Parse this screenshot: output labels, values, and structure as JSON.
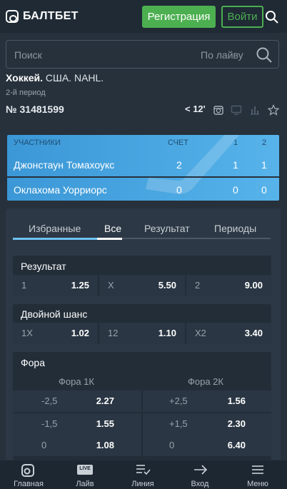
{
  "header": {
    "logo_text": "БАЛТБЕТ",
    "register_label": "Регистрация",
    "login_label": "Войти"
  },
  "search": {
    "placeholder": "Поиск",
    "filter_label": "По лайву"
  },
  "event": {
    "sport": "Хоккей.",
    "league": "США. NAHL.",
    "period": "2-й период",
    "number": "№ 31481599",
    "timer": "< 12'"
  },
  "scoreboard": {
    "headers": {
      "participants": "УЧАСТНИКИ",
      "score": "СЧЕТ",
      "p1": "1",
      "p2": "2"
    },
    "teams": [
      {
        "name": "Джонстаун Томахоукс",
        "score": "2",
        "p1": "1",
        "p2": "1"
      },
      {
        "name": "Оклахома Уорриорс",
        "score": "0",
        "p1": "0",
        "p2": "0"
      }
    ]
  },
  "tabs": [
    "Избранные",
    "Все",
    "Результат",
    "Периоды"
  ],
  "active_tab": "Все",
  "markets": {
    "result": {
      "title": "Результат",
      "odds": [
        {
          "k": "1",
          "v": "1.25"
        },
        {
          "k": "X",
          "v": "5.50"
        },
        {
          "k": "2",
          "v": "9.00"
        }
      ]
    },
    "double": {
      "title": "Двойной шанс",
      "odds": [
        {
          "k": "1X",
          "v": "1.02"
        },
        {
          "k": "12",
          "v": "1.10"
        },
        {
          "k": "X2",
          "v": "3.40"
        }
      ]
    },
    "fora": {
      "title": "Фора",
      "col1": "Фора 1К",
      "col2": "Фора 2К",
      "rows": [
        {
          "k1": "-2,5",
          "v1": "2.27",
          "k2": "+2,5",
          "v2": "1.56"
        },
        {
          "k1": "-1,5",
          "v1": "1.55",
          "k2": "+1,5",
          "v2": "2.30"
        },
        {
          "k1": "0",
          "v1": "1.08",
          "k2": "0",
          "v2": "6.40"
        }
      ]
    }
  },
  "nav": [
    "Главная",
    "Лайв",
    "Линия",
    "Вход",
    "Меню"
  ],
  "nav_live_badge": "LIVE",
  "colors": {
    "accent_green": "#4caf50",
    "scoreboard_blue": "#4aa7e2",
    "background": "#26313c"
  }
}
